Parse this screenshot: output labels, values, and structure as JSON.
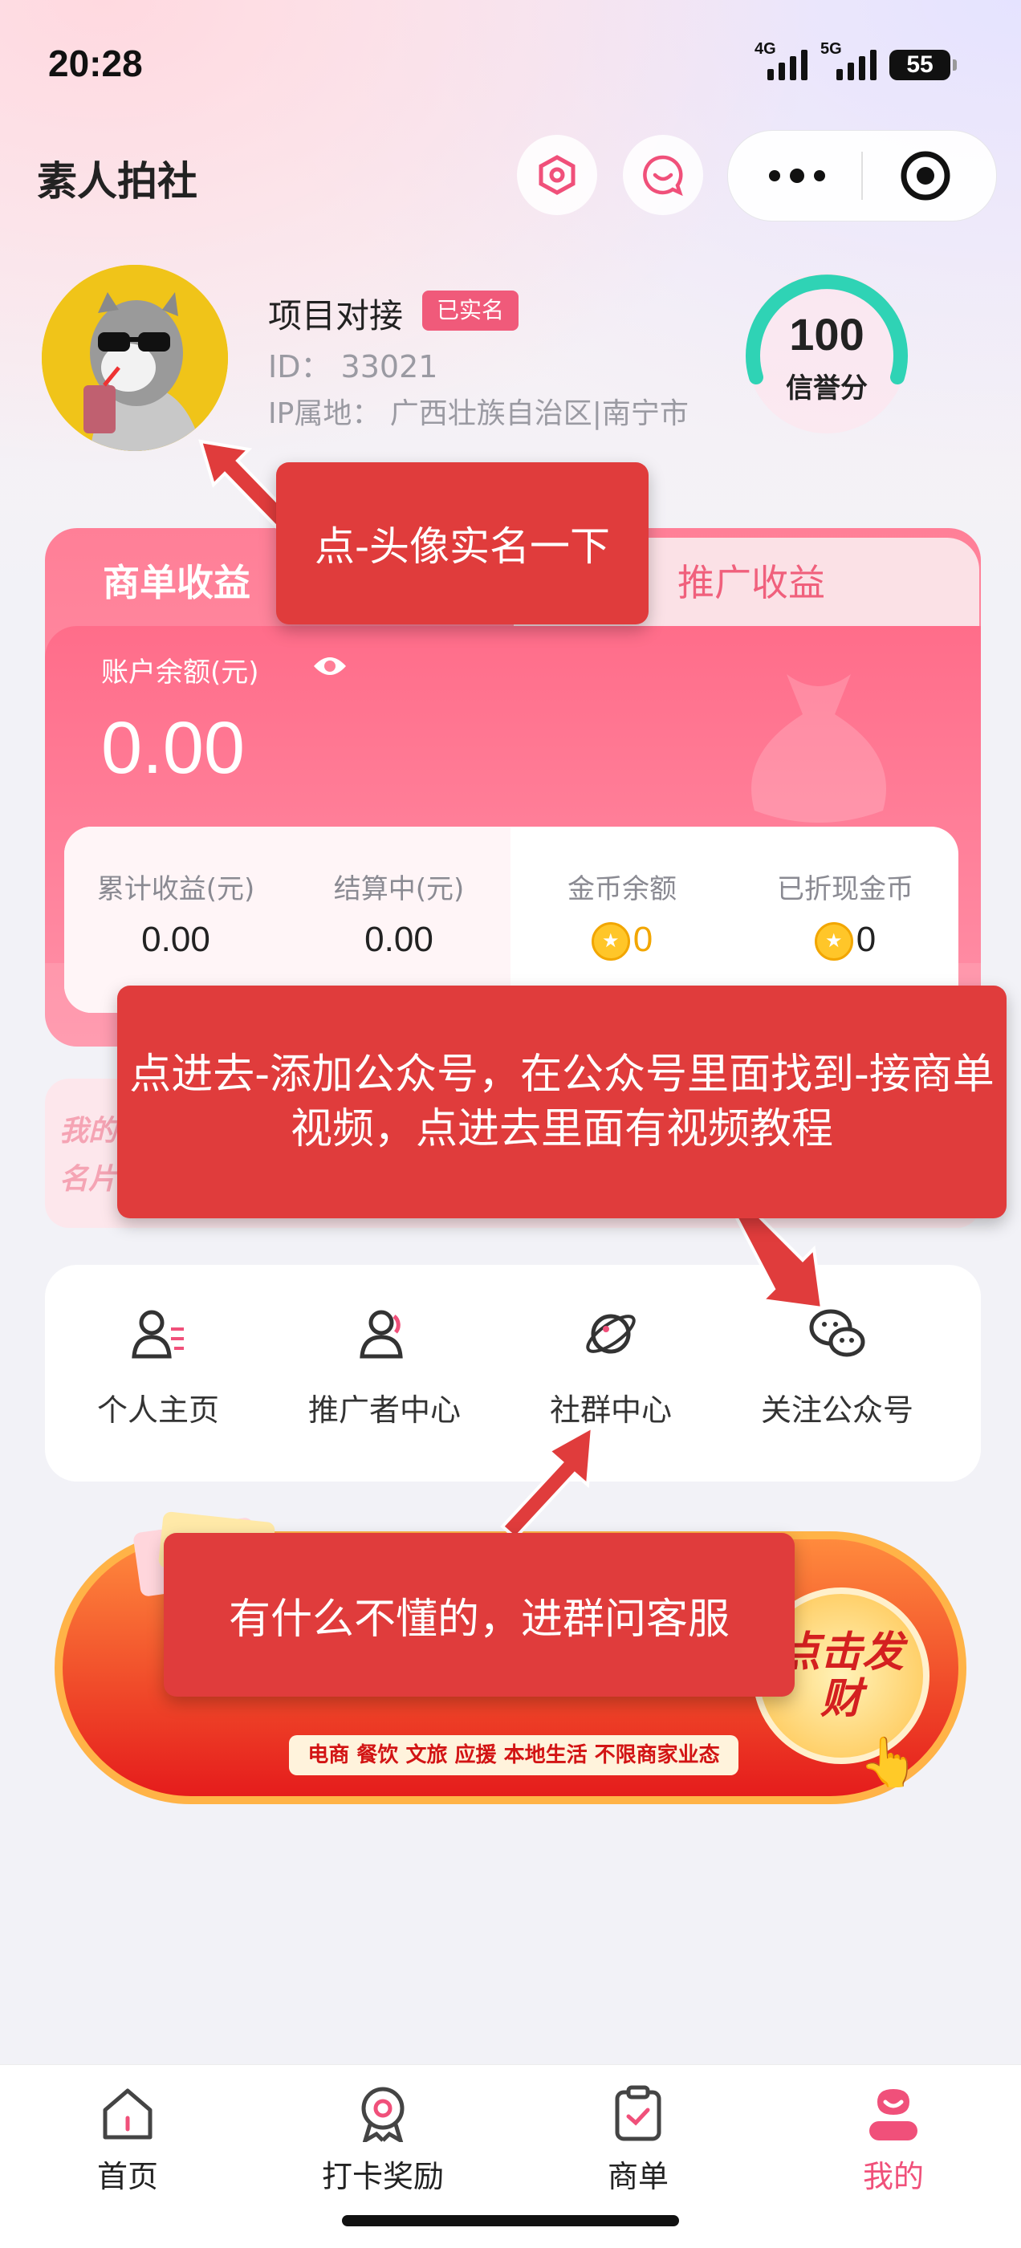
{
  "status_bar": {
    "time": "20:28",
    "signal1_label": "4G",
    "signal2_label": "5G",
    "battery": "55"
  },
  "header": {
    "title": "素人拍社"
  },
  "profile": {
    "name": "项目对接",
    "verified_badge": "已实名",
    "id_line": "ID： 33021",
    "ip_line": "IP属地： 广西壮族自治区|南宁市",
    "credit_score": "100",
    "credit_label": "信誉分"
  },
  "earnings": {
    "tab_active": "商单收益",
    "tab_inactive": "推广收益",
    "balance_label": "账户余额(元)",
    "balance_value": "0.00",
    "stats": [
      {
        "label": "累计收益(元)",
        "value": "0.00"
      },
      {
        "label": "结算中(元)",
        "value": "0.00"
      },
      {
        "label": "金币余额",
        "value": "0"
      },
      {
        "label": "已折现金币",
        "value": "0"
      }
    ]
  },
  "business_card": {
    "line1": "我的",
    "line2": "名片"
  },
  "menu": {
    "items": [
      {
        "label": "个人主页"
      },
      {
        "label": "推广者中心"
      },
      {
        "label": "社群中心"
      },
      {
        "label": "关注公众号"
      }
    ]
  },
  "promo": {
    "tags": "电商 餐饮 文旅 应援 本地生活 不限商家业态",
    "cta": "点击发财"
  },
  "annotations": {
    "note1": "点-头像实名一下",
    "note2": "点进去-添加公众号，在公众号里面找到-接商单视频，点进去里面有视频教程",
    "note3": "有什么不懂的，进群问客服"
  },
  "tabbar": {
    "items": [
      {
        "label": "首页"
      },
      {
        "label": "打卡奖励"
      },
      {
        "label": "商单"
      },
      {
        "label": "我的"
      }
    ]
  },
  "colors": {
    "accent": "#f0507a",
    "annotation": "#e03c3c",
    "score_arc": "#2fd3b5"
  }
}
